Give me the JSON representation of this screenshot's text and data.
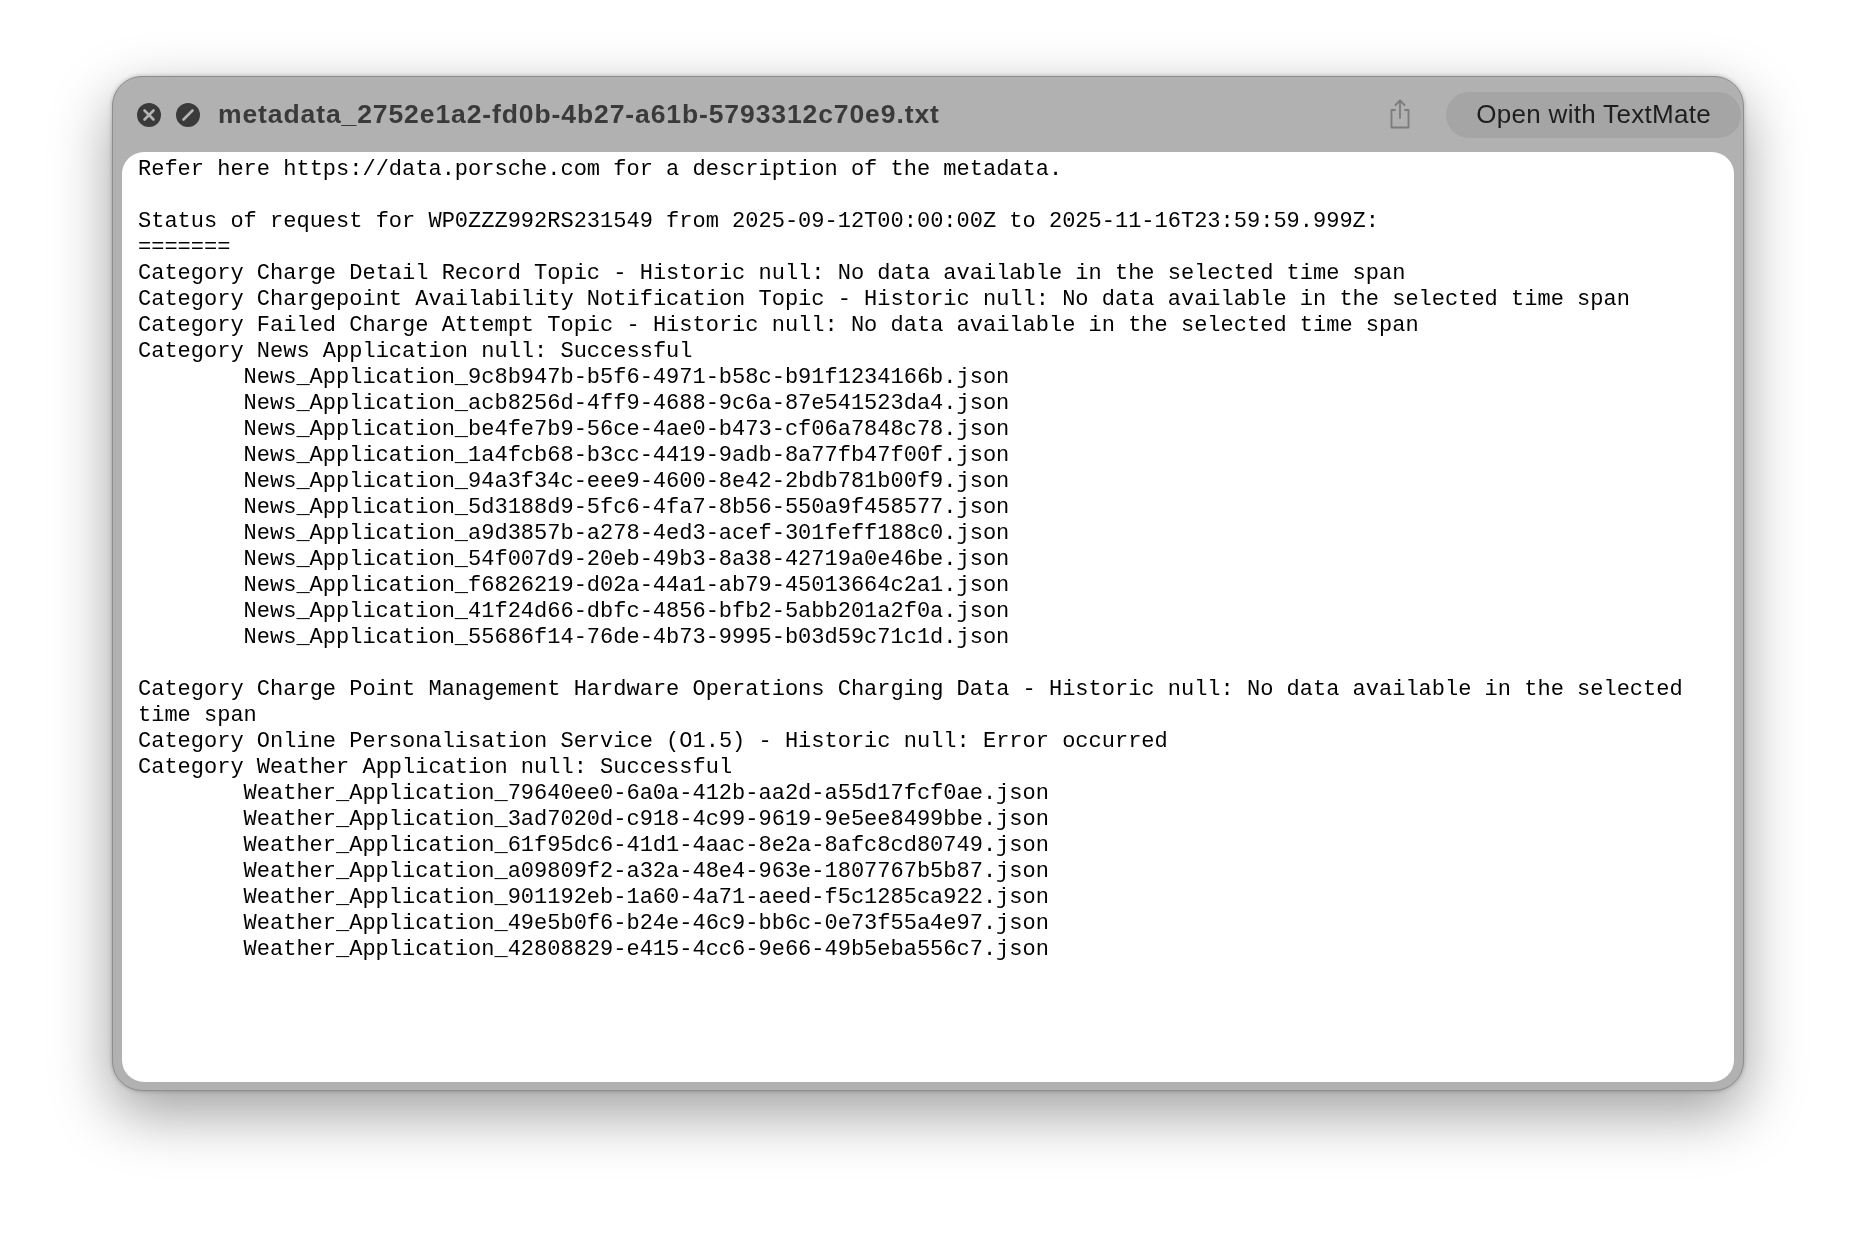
{
  "window": {
    "title": "metadata_2752e1a2-fd0b-4b27-a61b-5793312c70e9.txt",
    "open_button": "Open with TextMate"
  },
  "document": {
    "intro": "Refer here https://data.porsche.com for a description of the metadata.",
    "status": "Status of request for WP0ZZZ992RS231549 from 2025-09-12T00:00:00Z to 2025-11-16T23:59:59.999Z:",
    "separator": "=======",
    "categories": [
      {
        "text": "Category Charge Detail Record Topic - Historic null: No data available in the selected time span"
      },
      {
        "text": "Category Chargepoint Availability Notification Topic - Historic null: No data available in the selected time span"
      },
      {
        "text": "Category Failed Charge Attempt Topic - Historic null: No data available in the selected time span"
      },
      {
        "text": "Category News Application null: Successful",
        "files": [
          "News_Application_9c8b947b-b5f6-4971-b58c-b91f1234166b.json",
          "News_Application_acb8256d-4ff9-4688-9c6a-87e541523da4.json",
          "News_Application_be4fe7b9-56ce-4ae0-b473-cf06a7848c78.json",
          "News_Application_1a4fcb68-b3cc-4419-9adb-8a77fb47f00f.json",
          "News_Application_94a3f34c-eee9-4600-8e42-2bdb781b00f9.json",
          "News_Application_5d3188d9-5fc6-4fa7-8b56-550a9f458577.json",
          "News_Application_a9d3857b-a278-4ed3-acef-301feff188c0.json",
          "News_Application_54f007d9-20eb-49b3-8a38-42719a0e46be.json",
          "News_Application_f6826219-d02a-44a1-ab79-45013664c2a1.json",
          "News_Application_41f24d66-dbfc-4856-bfb2-5abb201a2f0a.json",
          "News_Application_55686f14-76de-4b73-9995-b03d59c71c1d.json"
        ]
      },
      {
        "text": "Category Charge Point Management Hardware Operations Charging Data - Historic null: No data available in the selected time span"
      },
      {
        "text": "Category Online Personalisation Service (O1.5) - Historic null: Error occurred"
      },
      {
        "text": "Category Weather Application null: Successful",
        "files": [
          "Weather_Application_79640ee0-6a0a-412b-aa2d-a55d17fcf0ae.json",
          "Weather_Application_3ad7020d-c918-4c99-9619-9e5ee8499bbe.json",
          "Weather_Application_61f95dc6-41d1-4aac-8e2a-8afc8cd80749.json",
          "Weather_Application_a09809f2-a32a-48e4-963e-1807767b5b87.json",
          "Weather_Application_901192eb-1a60-4a71-aeed-f5c1285ca922.json",
          "Weather_Application_49e5b0f6-b24e-46c9-bb6c-0e73f55a4e97.json",
          "Weather_Application_42808829-e415-4cc6-9e66-49b5eba556c7.json"
        ]
      }
    ]
  }
}
